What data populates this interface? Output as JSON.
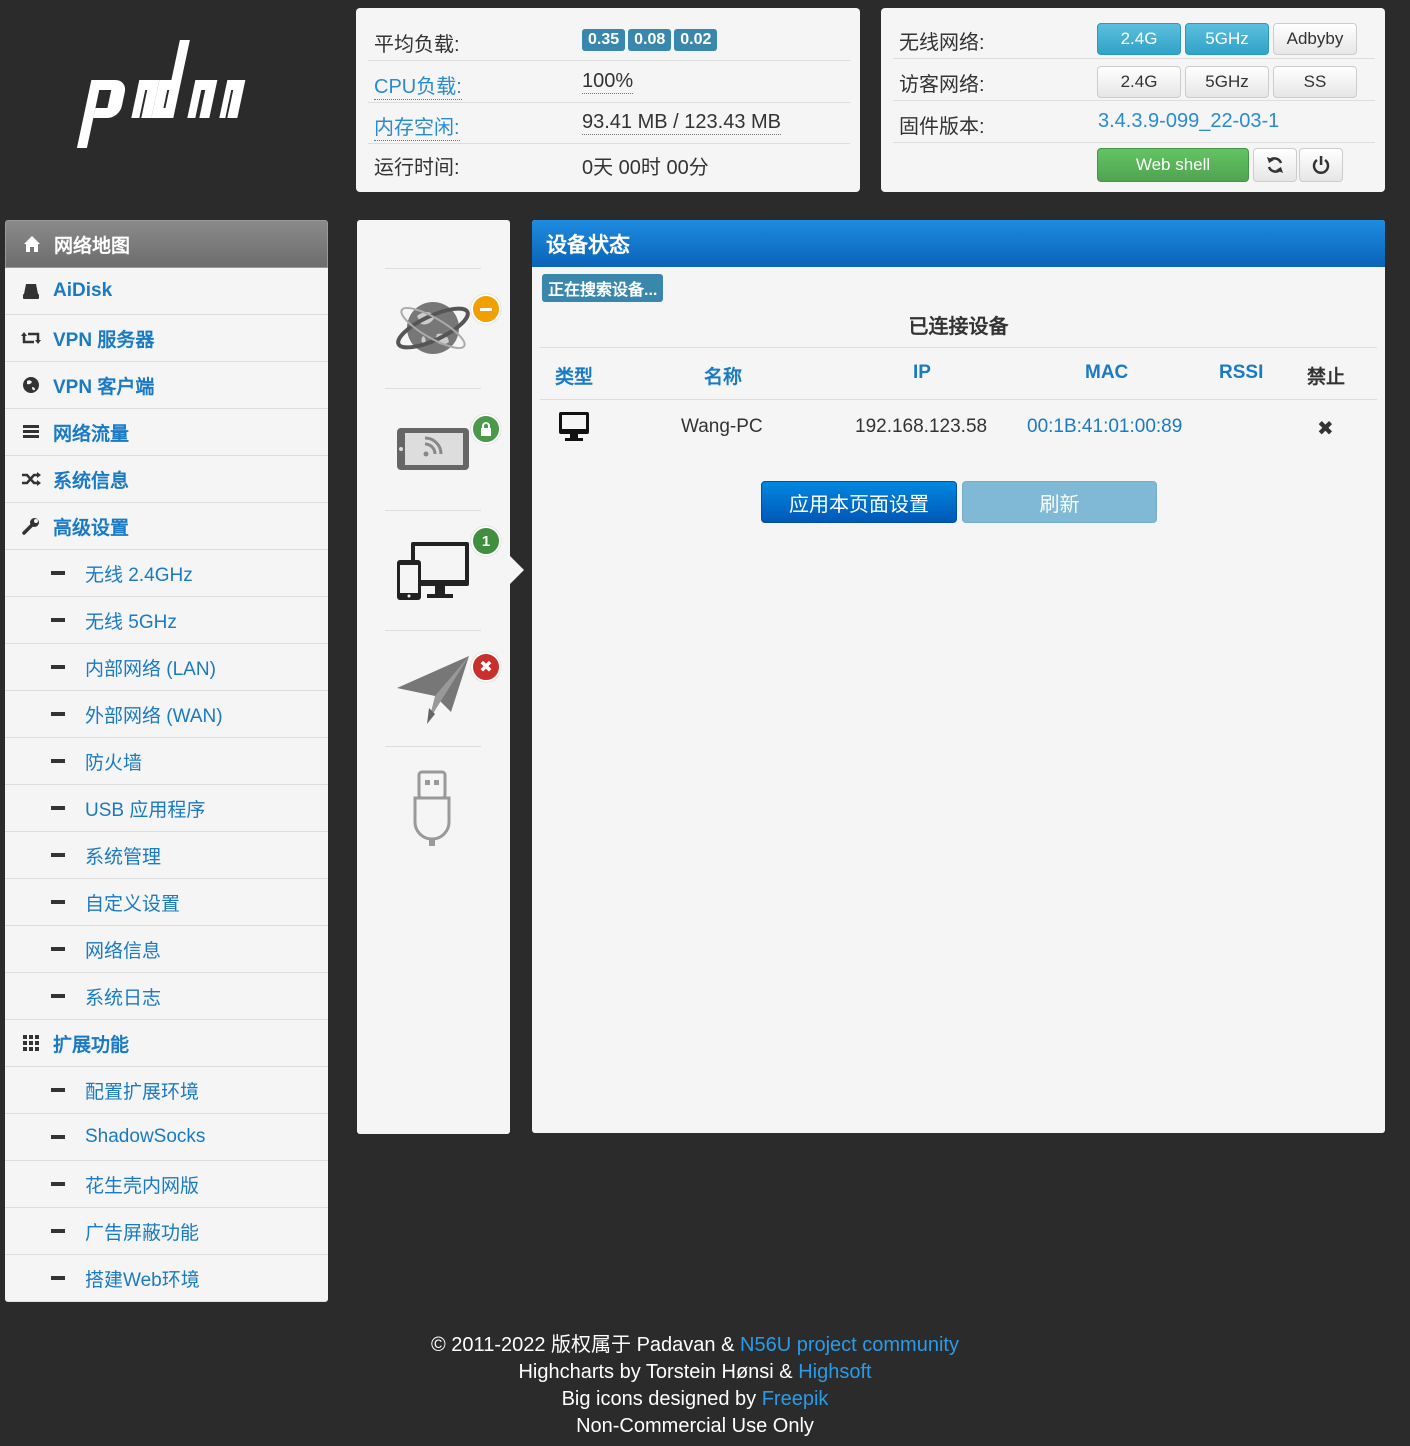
{
  "logo": {
    "text": "padavan"
  },
  "system": {
    "load_label": "平均负载:",
    "load_values": [
      "0.35",
      "0.08",
      "0.02"
    ],
    "cpu_label": "CPU负载:",
    "cpu_value": "100%",
    "mem_label": "内存空闲:",
    "mem_value": "93.41 MB / 123.43 MB",
    "uptime_label": "运行时间:",
    "uptime_value": "0天 00时 00分"
  },
  "network": {
    "wireless_label": "无线网络:",
    "wireless_buttons": [
      "2.4G",
      "5GHz",
      "Adbyby"
    ],
    "guest_label": "访客网络:",
    "guest_buttons": [
      "2.4G",
      "5GHz",
      "SS"
    ],
    "firmware_label": "固件版本:",
    "firmware_value": "3.4.3.9-099_22-03-1",
    "webshell_label": "Web shell"
  },
  "sidebar": {
    "items": [
      {
        "label": "网络地图",
        "icon": "home-icon",
        "active": true
      },
      {
        "label": "AiDisk",
        "icon": "disk-icon"
      },
      {
        "label": "VPN 服务器",
        "icon": "retweet-icon"
      },
      {
        "label": "VPN 客户端",
        "icon": "globe-icon"
      },
      {
        "label": "网络流量",
        "icon": "list-icon"
      },
      {
        "label": "系统信息",
        "icon": "random-icon"
      },
      {
        "label": "高级设置",
        "icon": "wrench-icon"
      }
    ],
    "advanced_sub": [
      "无线 2.4GHz",
      "无线 5GHz",
      "内部网络 (LAN)",
      "外部网络 (WAN)",
      "防火墙",
      "USB 应用程序",
      "系统管理",
      "自定义设置",
      "网络信息",
      "系统日志"
    ],
    "ext_label": "扩展功能",
    "ext_icon": "grid-icon",
    "ext_sub": [
      "配置扩展环境",
      "ShadowSocks",
      "花生壳内网版",
      "广告屏蔽功能",
      "搭建Web环境"
    ]
  },
  "status_icons": {
    "clients_count": "1"
  },
  "main": {
    "title": "设备状态",
    "searching": "正在搜索设备...",
    "section_title": "已连接设备",
    "columns": [
      "类型",
      "名称",
      "IP",
      "MAC",
      "RSSI",
      "禁止"
    ],
    "rows": [
      {
        "type_icon": "desktop-icon",
        "name": "Wang-PC",
        "ip": "192.168.123.58",
        "mac": "00:1B:41:01:00:89",
        "rssi": "",
        "block": "✖"
      }
    ],
    "apply_label": "应用本页面设置",
    "refresh_label": "刷新"
  },
  "footer": {
    "line1_text": "© 2011-2022 版权属于 Padavan & ",
    "line1_link": "N56U project community",
    "line2_text": "Highcharts by Torstein Hønsi & ",
    "line2_link": "Highsoft",
    "line3_text": "Big icons designed by ",
    "line3_link": "Freepik",
    "line4_text": "Non-Commercial Use Only"
  },
  "colors": {
    "accent": "#1a7ac4",
    "header_blue": "#0a63b8",
    "badge": "#3a87ad",
    "green": "#51a351",
    "background": "#2b2b2b"
  }
}
